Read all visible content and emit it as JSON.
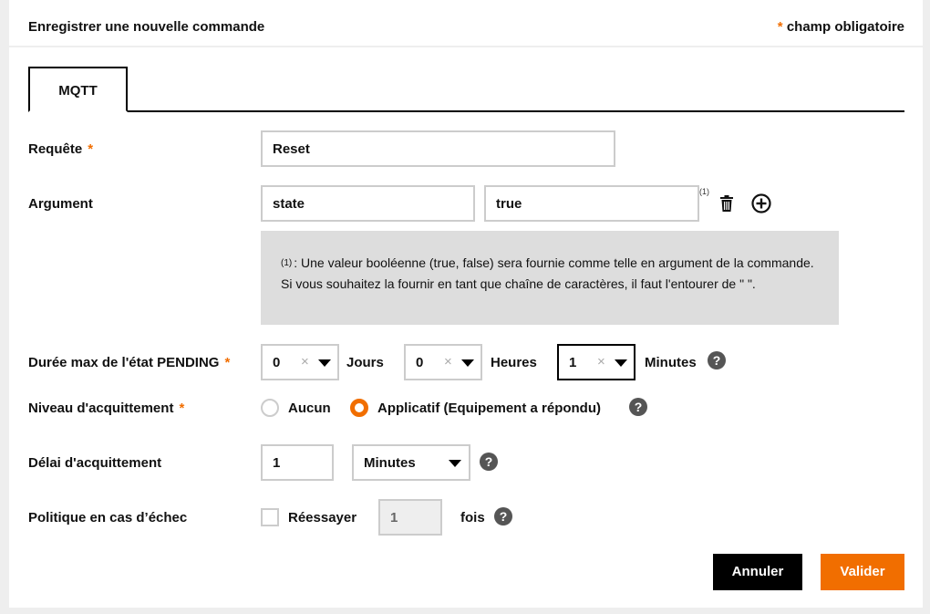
{
  "header": {
    "title": "Enregistrer une nouvelle commande",
    "required_star": "*",
    "required_label": "champ obligatoire"
  },
  "tabs": [
    {
      "label": "MQTT",
      "active": true
    }
  ],
  "request": {
    "label": "Requête",
    "star": "*",
    "value": "Reset"
  },
  "argument": {
    "label": "Argument",
    "key": "state",
    "value": "true",
    "footnote_ref": "(1)",
    "delete_icon": "trash-icon",
    "add_icon": "plus-circle-icon"
  },
  "note": {
    "ref": "(1)",
    "text": ": Une valeur booléenne (true, false) sera fournie comme telle en argument de la commande. Si vous souhaitez la fournir en tant que chaîne de caractères, il faut l'entourer de \" \"."
  },
  "pending": {
    "label": "Durée max de l'état PENDING",
    "star": "*",
    "days_value": "0",
    "days_label": "Jours",
    "hours_value": "0",
    "hours_label": "Heures",
    "minutes_value": "1",
    "minutes_label": "Minutes",
    "clear_symbol": "×",
    "help_symbol": "?"
  },
  "ack_level": {
    "label": "Niveau d'acquittement",
    "star": "*",
    "options": [
      {
        "label": "Aucun",
        "checked": false
      },
      {
        "label": "Applicatif (Equipement a répondu)",
        "checked": true
      }
    ],
    "help_symbol": "?"
  },
  "ack_delay": {
    "label": "Délai d'acquittement",
    "value": "1",
    "unit": "Minutes",
    "help_symbol": "?"
  },
  "failure_policy": {
    "label": "Politique en cas d’échec",
    "retry_label": "Réessayer",
    "retry_checked": false,
    "times_value": "1",
    "times_label": "fois",
    "help_symbol": "?"
  },
  "actions": {
    "cancel": "Annuler",
    "submit": "Valider"
  },
  "colors": {
    "accent": "#f16e00",
    "dark": "#000000",
    "note_bg": "#dddddd"
  }
}
